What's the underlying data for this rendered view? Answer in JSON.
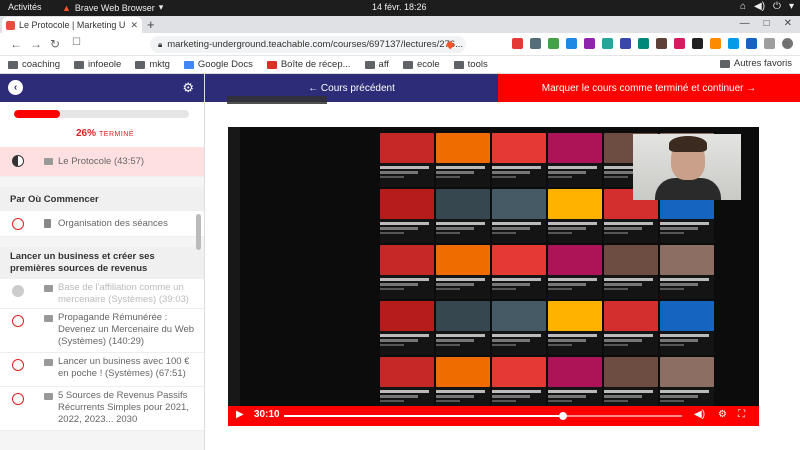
{
  "os": {
    "activities": "Activités",
    "app_name": "Brave Web Browser",
    "clock": "14 févr. 18:26"
  },
  "browser": {
    "tab_title": "Le Protocole | Marketing U",
    "url": "marketing-underground.teachable.com/courses/697137/lectures/276...",
    "bookmarks": [
      "coaching",
      "infoeole",
      "mktg",
      "Google Docs",
      "Boîte de récep...",
      "aff",
      "ecole",
      "tools"
    ],
    "other_bookmarks": "Autres favoris"
  },
  "course": {
    "progress_percent": "26%",
    "progress_fraction": 0.26,
    "progress_label": "TERMINÉ",
    "prev_label": "← Cours précédent",
    "next_label": "Marquer le cours comme terminé et continuer →",
    "current_lecture": "Le Protocole (43:57)",
    "section1_title": "Par Où Commencer",
    "section1_lecture": "Organisation des séances",
    "section2_title": "Lancer un business et créer ses premières sources de revenus",
    "section2_lectures": [
      "Base de l'affiliation comme un mercenaire (Systèmes) (39:03)",
      "Propagande Rémunérée : Devenez un Mercenaire du Web (Systèmes) (140:29)",
      "Lancer un business avec 100 € en poche ! (Systèmes) (67:51)",
      "5 Sources de Revenus Passifs Récurrents Simples pour 2021, 2022, 2023... 2030"
    ]
  },
  "video": {
    "time": "30:10",
    "progress_fraction": 0.69
  },
  "colors": {
    "brand_blue": "#2d2c79",
    "accent_red": "#ff0000"
  }
}
